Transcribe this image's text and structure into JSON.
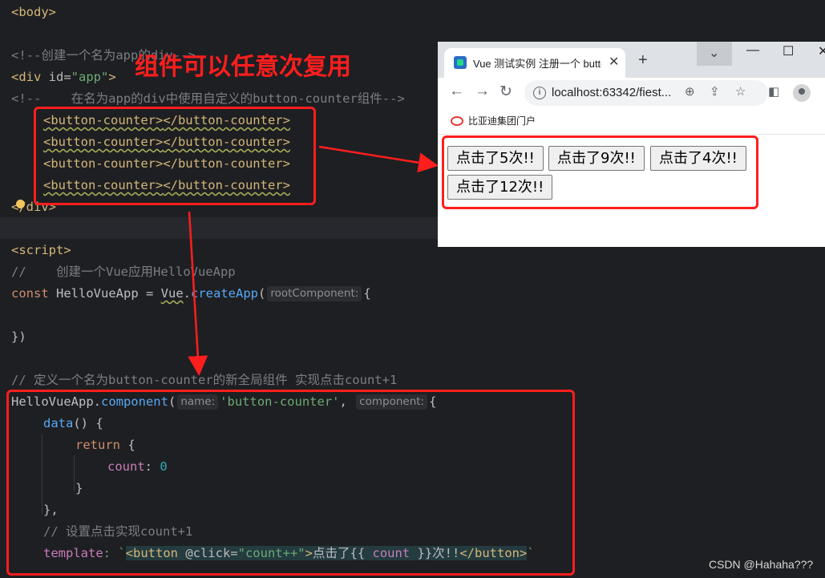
{
  "annotation": "组件可以任意次复用",
  "code_lines": {
    "l1": "<body>",
    "l2": "<!--创建一个名为app的div-->",
    "l3_tag": "<div ",
    "l3_attr": "id=",
    "l3_str": "\"app\"",
    "l3_close": ">",
    "l4": "<!--    在名为app的div中使用自定义的button-counter组件-->",
    "l5_open": "<button-counter>",
    "l5_close": "</button-counter>",
    "l9": "</div>",
    "l11": "<script>",
    "l12": "//    创建一个Vue应用HelloVueApp",
    "l13_kw": "const ",
    "l13_var": "HelloVueApp = ",
    "l13_vue": "Vue",
    "l13_dot": ".",
    "l13_fn": "createApp",
    "l13_paren": "(",
    "l13_hint": "rootComponent:",
    "l13_brace": "{",
    "l15": "})",
    "l17": "// 定义一个名为button-counter的新全局组件 实现点击count+1",
    "l18_var": "HelloVueApp.",
    "l18_fn": "component",
    "l18_paren": "(",
    "l18_hint1": "name:",
    "l18_str": "'button-counter'",
    "l18_comma": ",",
    "l18_hint2": "component:",
    "l18_brace": "{",
    "l19_fn": "data",
    "l19_rest": "() {",
    "l20_kw": "return ",
    "l20_brace": "{",
    "l21_prop": "count",
    "l21_colon": ": ",
    "l21_num": "0",
    "l22": "}",
    "l23": "},",
    "l24": "// 设置点击实现count+1",
    "l25_prop": "template",
    "l25_colon": ": `",
    "l25_tag1": "<button ",
    "l25_attr": "@click=",
    "l25_str": "\"count++\"",
    "l25_gt": ">",
    "l25_text": "点击了{{ ",
    "l25_count": "count",
    "l25_text2": " }}次!!",
    "l25_tag2": "</button>",
    "l25_bt": "`"
  },
  "browser": {
    "tab_title": "Vue 测试实例 注册一个 button",
    "tab_close": "✕",
    "new_tab": "+",
    "url": "localhost:63342/fiest...",
    "bookmark": "比亚迪集团门户",
    "buttons": [
      "点击了5次!!",
      "点击了9次!!",
      "点击了4次!!",
      "点击了12次!!"
    ]
  },
  "watermark": "CSDN @Hahaha???"
}
